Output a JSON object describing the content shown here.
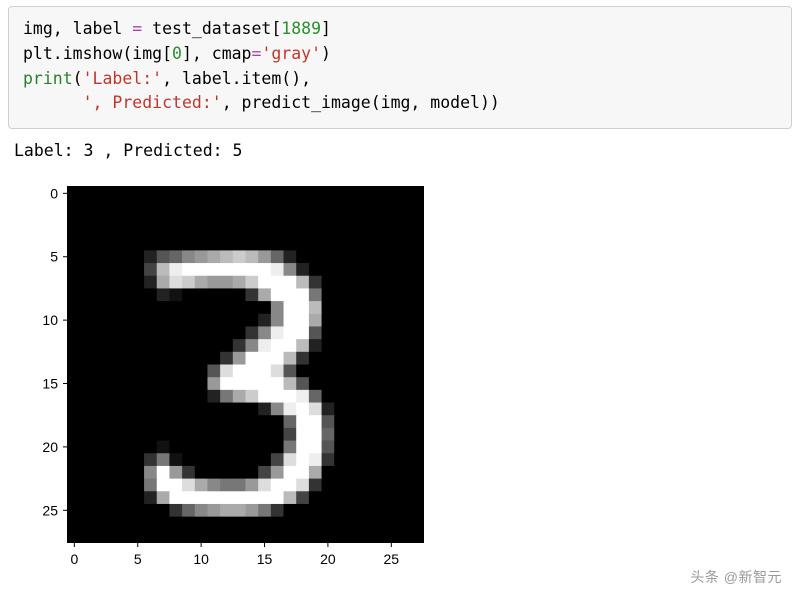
{
  "code": {
    "line1": {
      "a": "img, label ",
      "eq": "=",
      "b": " test_dataset[",
      "idx": "1889",
      "c": "]"
    },
    "line2": {
      "a": "plt.imshow(img[",
      "zero": "0",
      "b": "], cmap",
      "eq": "=",
      "str": "'gray'",
      "c": ")"
    },
    "line3": {
      "fn": "print",
      "open": "(",
      "str": "'Label:'",
      "rest": ", label.item(),"
    },
    "line4": {
      "indent": "      ",
      "str": "', Predicted:'",
      "rest": ", predict_image(img, model))"
    }
  },
  "output": {
    "text": "Label: 3 , Predicted: 5"
  },
  "chart_data": {
    "type": "heatmap",
    "title": "",
    "xlabel": "",
    "ylabel": "",
    "x_ticks": [
      0,
      5,
      10,
      15,
      20,
      25
    ],
    "y_ticks": [
      0,
      5,
      10,
      15,
      20,
      25
    ],
    "xlim": [
      -0.5,
      27.5
    ],
    "ylim": [
      27.5,
      -0.5
    ],
    "cmap": "gray",
    "size": [
      28,
      28
    ],
    "description": "28x28 MNIST grayscale image depicting the handwritten digit 3",
    "pixels_hex_rows": [
      "0000000000000000000000000000",
      "0000000000000000000000000000",
      "0000000000000000000000000000",
      "0000000000000000000000000000",
      "0000000000000000000000000000",
      "00000025689ABCB9620000000000",
      "0000004BEFFFFFFFE82000000000",
      "0000002ADCA99ACFFFB300000000",
      "000000021000003AFFF700000000",
      "00000000000000008FFB00000000",
      "00000000000000028FFA00000000",
      "0000000000000038EFF500000000",
      "000000000000038EFFB200000000",
      "00000000000039FFFB3000000000",
      "000000000005DFFFD50000000000",
      "000000000009FFFFFB5000000000",
      "0000000000027ACFFFE600000000",
      "00000000000000028EFD20000000",
      "000000000000000006FF50000000",
      "000000000000000004FF60000000",
      "000000010000000007FF50000000",
      "00000037100000004DFE30000000",
      "0000008F930000049FFA00000000",
      "0000007FFDA8779DFFD300000000",
      "0000002AFFFFFFFFFB4000000000",
      "000000003689AA9730000000000",
      "0000000000000000000000000000",
      "0000000000000000000000000000"
    ]
  },
  "watermark": "头条 @新智元"
}
